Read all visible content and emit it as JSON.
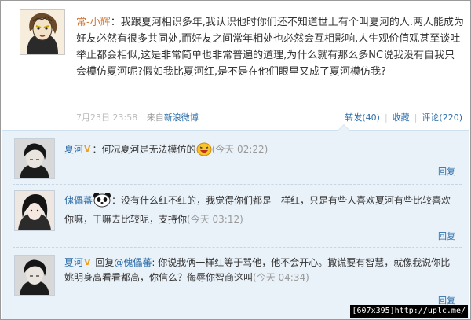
{
  "post": {
    "author": "常-小辉",
    "separator": "：",
    "text": "我跟夏河相识多年,我认识他时你们还不知道世上有个叫夏河的人.两人能成为好友必然有很多共同处,而好友之间常年相处也必然会互相影响,人生观价值观甚至谈吐举止都会相似,这是非常简单也非常普遍的道理,为什么就有那么多NC说我没有自我只会模仿夏河呢?假如我比夏河红,是不是在他们眼里又成了夏河模仿我?",
    "date": "7月23日 23:58",
    "source_prefix": "来自",
    "source_link": "新浪微博",
    "repost": "转发(40)",
    "favorite": "收藏",
    "comment": "评论(220)",
    "sep": "|"
  },
  "comments": [
    {
      "name": "夏河",
      "badge": "V",
      "text": "何况夏河是无法模仿的",
      "emoji": "laughing-emoji",
      "time": "(今天 02:22)",
      "reply": "回复"
    },
    {
      "name": "傀儡蕃",
      "emoji": "panda-emoji",
      "separator": "：",
      "text": "没有什么红不红的，我觉得你们都是一样红，只是有些人喜欢夏河有些比较喜欢你嘛，干嘛去比较呢，支持你",
      "time": "(今天 03:12)",
      "reply": "回复"
    },
    {
      "name": "夏河",
      "badge": "V",
      "reply_prefix": "回复",
      "reply_to": "@傀儡蕃",
      "separator": ":",
      "text": "你说我俩一样红等于骂他，他不会开心。撒谎要有智慧，就像我说你比姚明身高看看都高，你信么？侮辱你智商这叫",
      "time": "(今天 04:34)",
      "reply": "回复"
    }
  ],
  "watermark": "[607x395]http://uplc.me/"
}
